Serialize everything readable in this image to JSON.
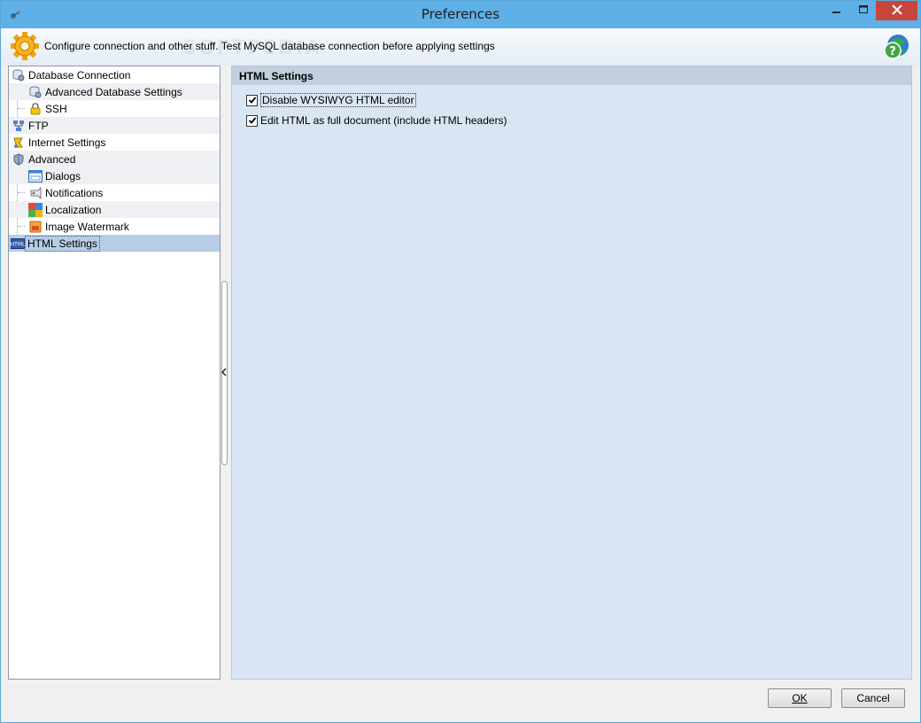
{
  "window": {
    "title": "Preferences"
  },
  "header": {
    "description": "Configure connection and other stuff. Test MySQL database connection before applying settings",
    "watermark": "SOFTPEDIA"
  },
  "tree": {
    "items": [
      {
        "label": "Database Connection",
        "icon": "database-icon"
      },
      {
        "label": "Advanced Database Settings",
        "icon": "database-settings-icon"
      },
      {
        "label": "SSH",
        "icon": "lock-icon"
      },
      {
        "label": "FTP",
        "icon": "network-icon"
      },
      {
        "label": "Internet Settings",
        "icon": "internet-icon"
      },
      {
        "label": "Advanced",
        "icon": "shield-icon"
      },
      {
        "label": "Dialogs",
        "icon": "dialog-icon"
      },
      {
        "label": "Notifications",
        "icon": "notification-icon"
      },
      {
        "label": "Localization",
        "icon": "localization-icon"
      },
      {
        "label": "Image Watermark",
        "icon": "image-icon"
      },
      {
        "label": "HTML Settings",
        "icon": "html-icon"
      }
    ],
    "selected": "HTML Settings"
  },
  "panel": {
    "title": "HTML Settings",
    "options": [
      {
        "label": "Disable WYSIWYG HTML editor",
        "checked": true
      },
      {
        "label": "Edit HTML as full document (include HTML headers)",
        "checked": true
      }
    ]
  },
  "buttons": {
    "ok": "OK",
    "cancel": "Cancel"
  },
  "colors": {
    "titlebar": "#5fb0e6",
    "close": "#c7463b",
    "panel_bg": "#d9e5f2",
    "panel_header": "#c1cfde",
    "selection": "#b6cde6"
  }
}
